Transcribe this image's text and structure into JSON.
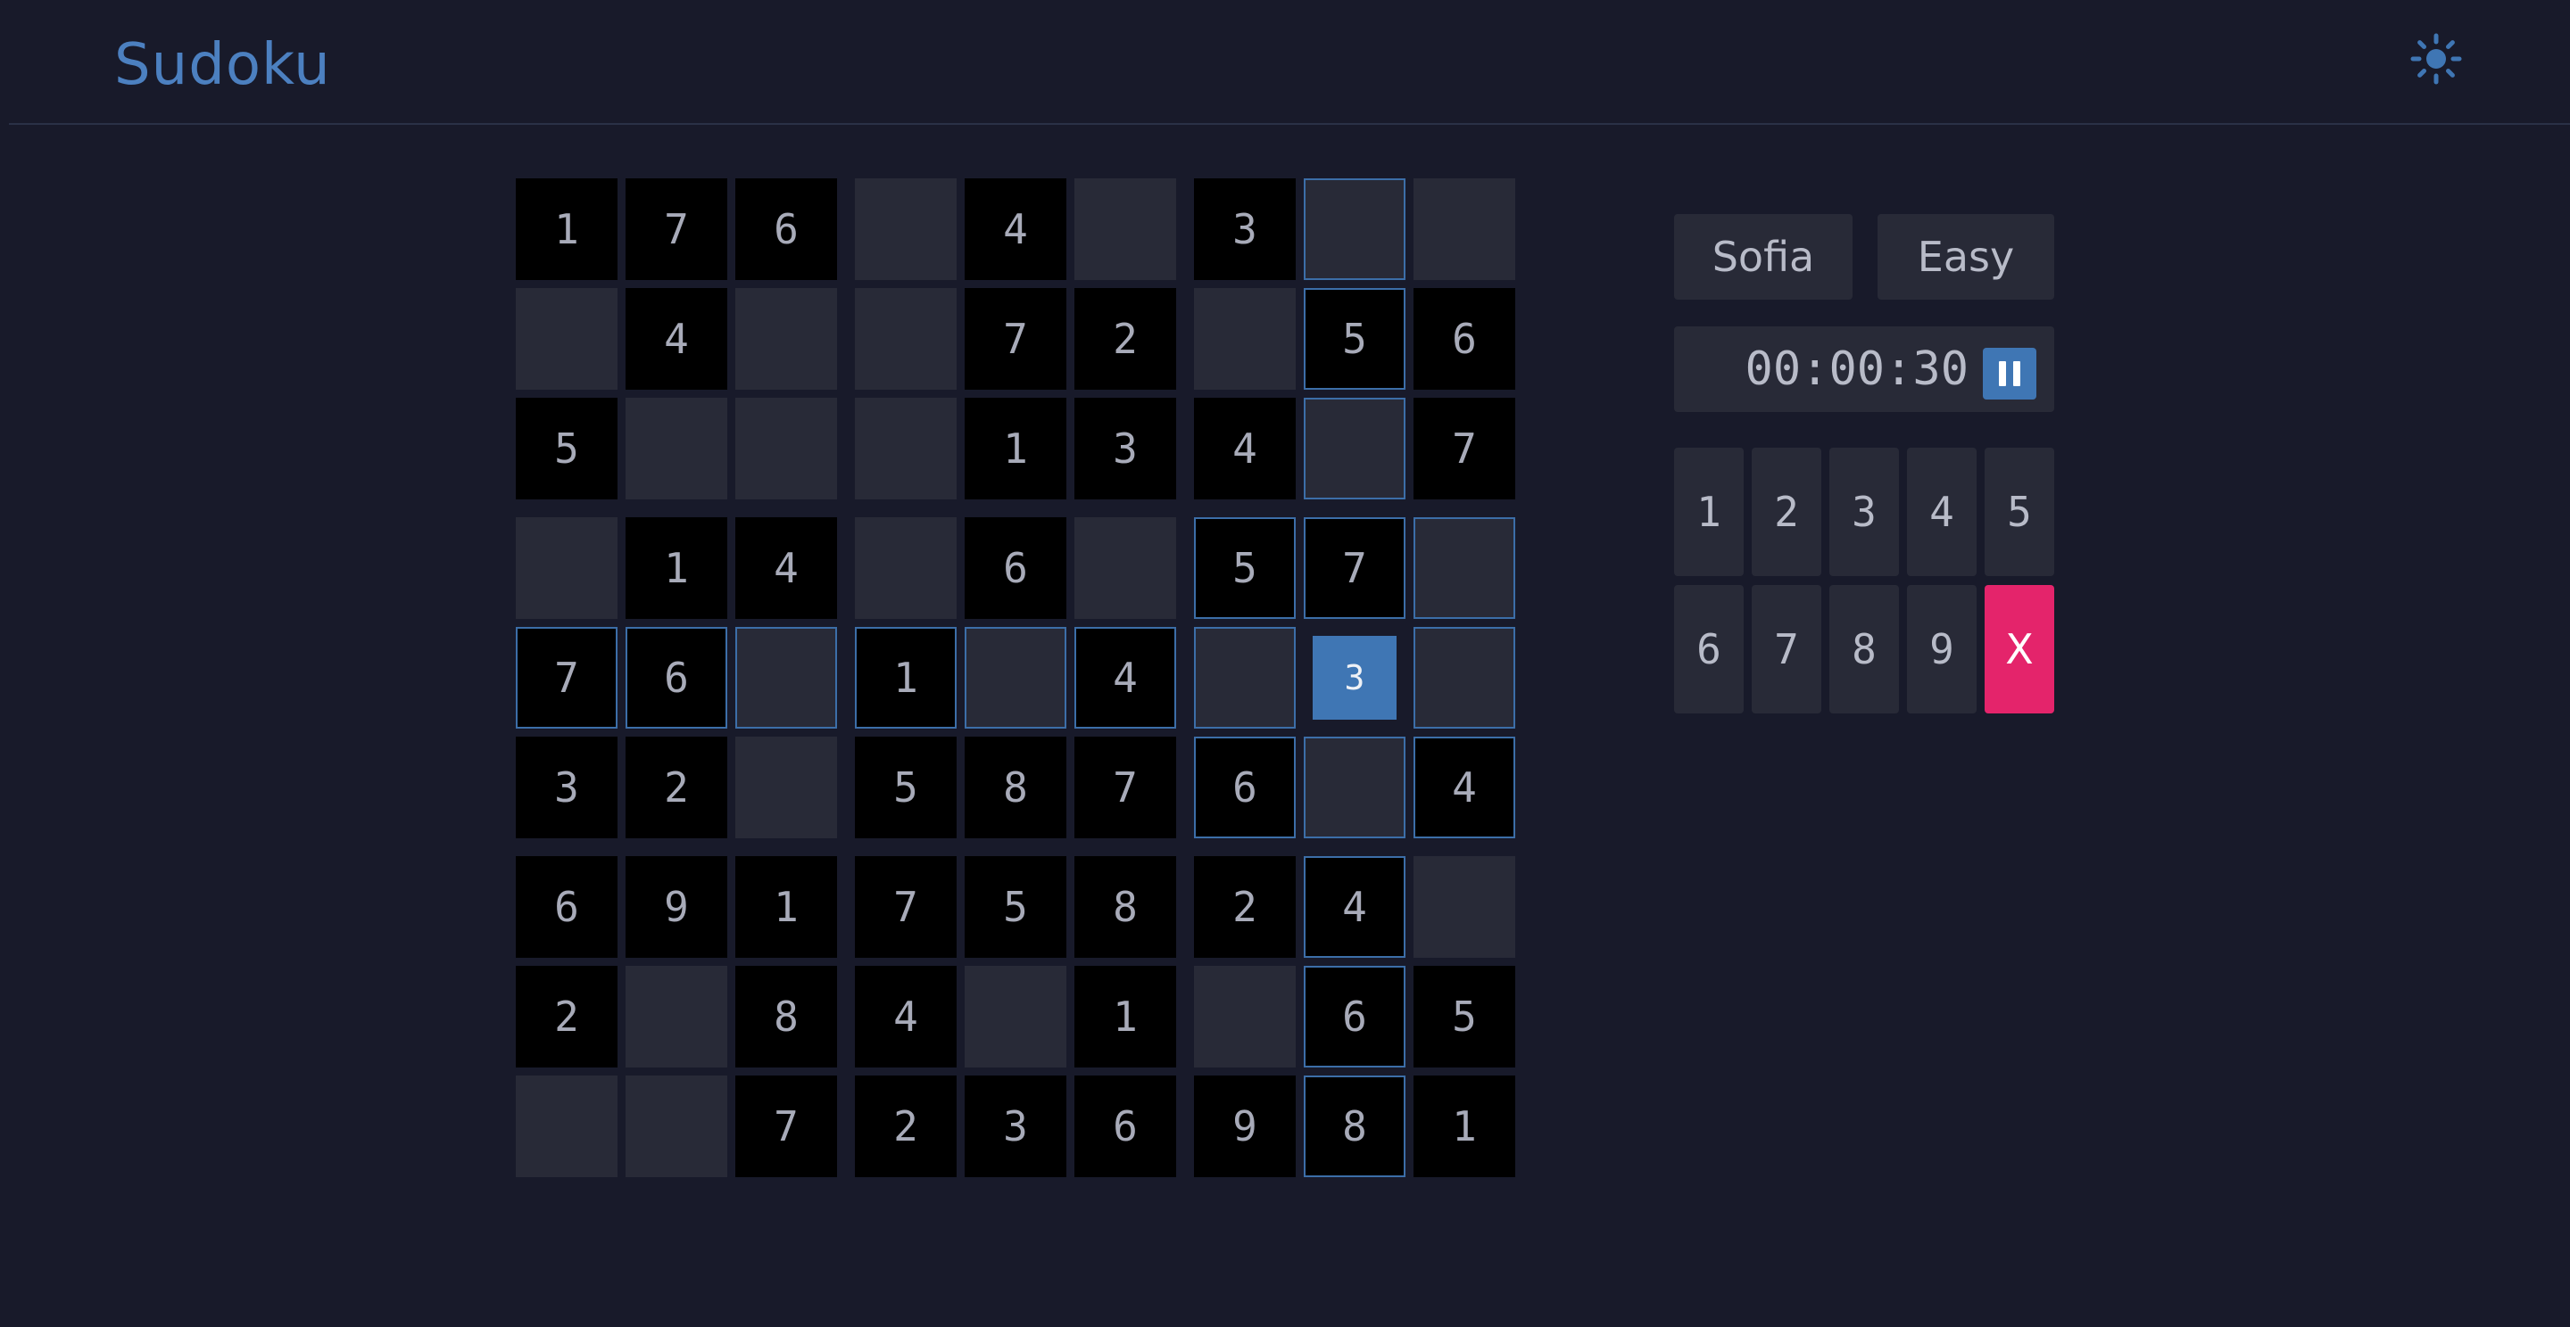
{
  "app": {
    "title": "Sudoku",
    "theme_icon": "sun-icon"
  },
  "colors": {
    "background": "#181a2a",
    "accent": "#3f76b4",
    "given_cell": "#000000",
    "empty_cell": "#282a37",
    "clear_button": "#e4246b"
  },
  "board": {
    "rows": [
      [
        "1",
        "7",
        "6",
        "",
        "4",
        "",
        "3",
        "",
        ""
      ],
      [
        "",
        "4",
        "",
        "",
        "7",
        "2",
        "",
        "5",
        "6"
      ],
      [
        "5",
        "",
        "",
        "",
        "1",
        "3",
        "4",
        "",
        "7"
      ],
      [
        "",
        "1",
        "4",
        "",
        "6",
        "",
        "5",
        "7",
        ""
      ],
      [
        "7",
        "6",
        "",
        "1",
        "",
        "4",
        "",
        "3",
        ""
      ],
      [
        "3",
        "2",
        "",
        "5",
        "8",
        "7",
        "6",
        "",
        "4"
      ],
      [
        "6",
        "9",
        "1",
        "7",
        "5",
        "8",
        "2",
        "4",
        ""
      ],
      [
        "2",
        "",
        "8",
        "4",
        "",
        "1",
        "",
        "6",
        "5"
      ],
      [
        "",
        "",
        "7",
        "2",
        "3",
        "6",
        "9",
        "8",
        "1"
      ]
    ],
    "selected": {
      "row": 4,
      "col": 7
    }
  },
  "player": {
    "name": "Sofia",
    "difficulty": "Easy"
  },
  "timer": {
    "value": "00:00:30",
    "state": "running",
    "pause_icon": "pause-icon"
  },
  "numpad": {
    "keys": [
      "1",
      "2",
      "3",
      "4",
      "5",
      "6",
      "7",
      "8",
      "9",
      "X"
    ]
  }
}
